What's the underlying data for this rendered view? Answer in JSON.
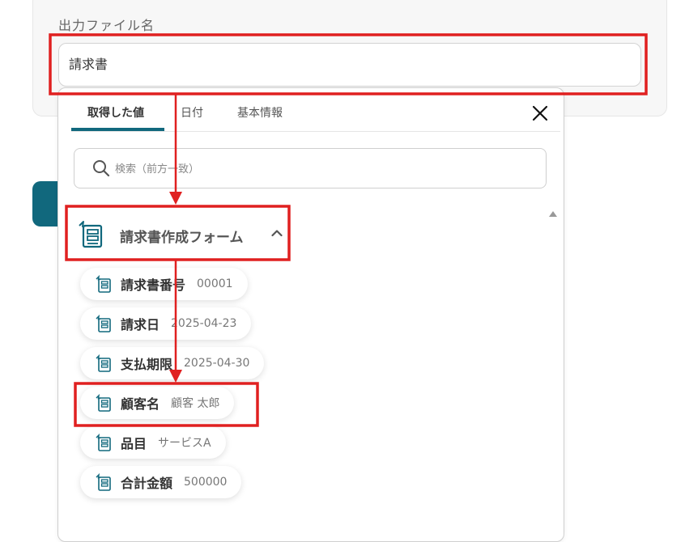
{
  "field": {
    "label": "出力ファイル名",
    "value": "請求書"
  },
  "tabs": [
    {
      "label": "取得した値",
      "active": true
    },
    {
      "label": "日付",
      "active": false
    },
    {
      "label": "基本情報",
      "active": false
    }
  ],
  "search": {
    "placeholder": "検索（前方一致）"
  },
  "group": {
    "label": "請求書作成フォーム"
  },
  "items": [
    {
      "label": "請求書番号",
      "value": "00001"
    },
    {
      "label": "請求日",
      "value": "2025-04-23"
    },
    {
      "label": "支払期限",
      "value": "2025-04-30"
    },
    {
      "label": "顧客名",
      "value": "顧客 太郎"
    },
    {
      "label": "品目",
      "value": "サービスA"
    },
    {
      "label": "合計金額",
      "value": "500000"
    }
  ],
  "colors": {
    "accent": "#11687d",
    "highlight": "#e02020"
  }
}
